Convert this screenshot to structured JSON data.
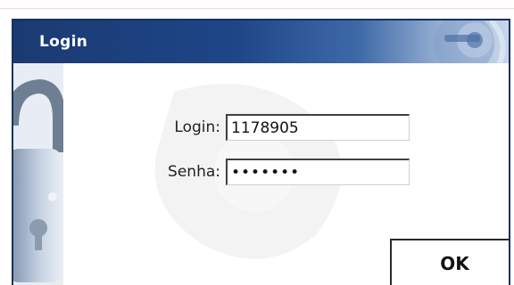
{
  "dialog": {
    "title": "Login"
  },
  "form": {
    "login_label": "Login:",
    "login_value": "1178905",
    "password_label": "Senha:",
    "password_value": "•••••••"
  },
  "buttons": {
    "ok_label": "OK"
  },
  "colors": {
    "titlebar": "#1e4688",
    "border": "#16325e"
  },
  "icons": {
    "title_decoration": "padlock-key-graphic",
    "side_decoration": "padlock-graphic"
  }
}
